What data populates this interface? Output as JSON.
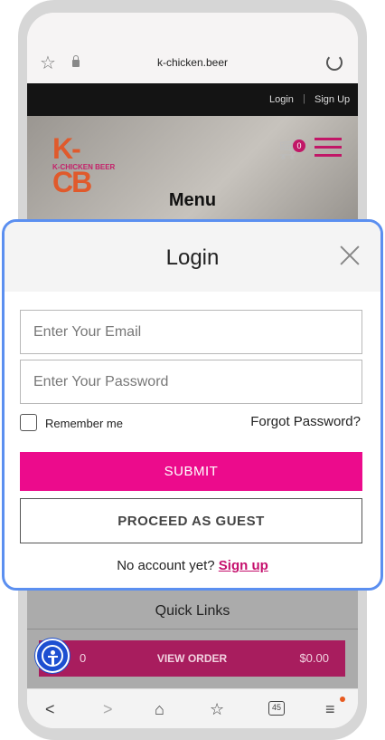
{
  "browser": {
    "url": "k-chicken.beer",
    "icons": {
      "favorite": "star-icon",
      "secure": "lock-icon",
      "reload": "reload-icon"
    }
  },
  "site": {
    "topbar": {
      "login": "Login",
      "separator": "|",
      "signup": "Sign Up"
    },
    "logo": {
      "mark": "K-CB",
      "text": "K-CHICKEN BEER"
    },
    "cart_count": "0",
    "hero_title": "Menu",
    "quick_links": "Quick Links",
    "order_bar": {
      "count": "0",
      "label": "VIEW ORDER",
      "total": "$0.00"
    }
  },
  "login_modal": {
    "title": "Login",
    "email_placeholder": "Enter Your Email",
    "password_placeholder": "Enter Your Password",
    "remember_label": "Remember me",
    "forgot_label": "Forgot Password?",
    "submit_label": "SUBMIT",
    "guest_label": "PROCEED AS GUEST",
    "no_account_text": "No account yet?",
    "signup_link": "Sign up"
  },
  "bottom_nav": {
    "tabs_count": "45"
  },
  "colors": {
    "accent": "#ec0b8c",
    "brand": "#c11767",
    "modal_border": "#5b8ff0",
    "a11y": "#1d4fd1"
  }
}
